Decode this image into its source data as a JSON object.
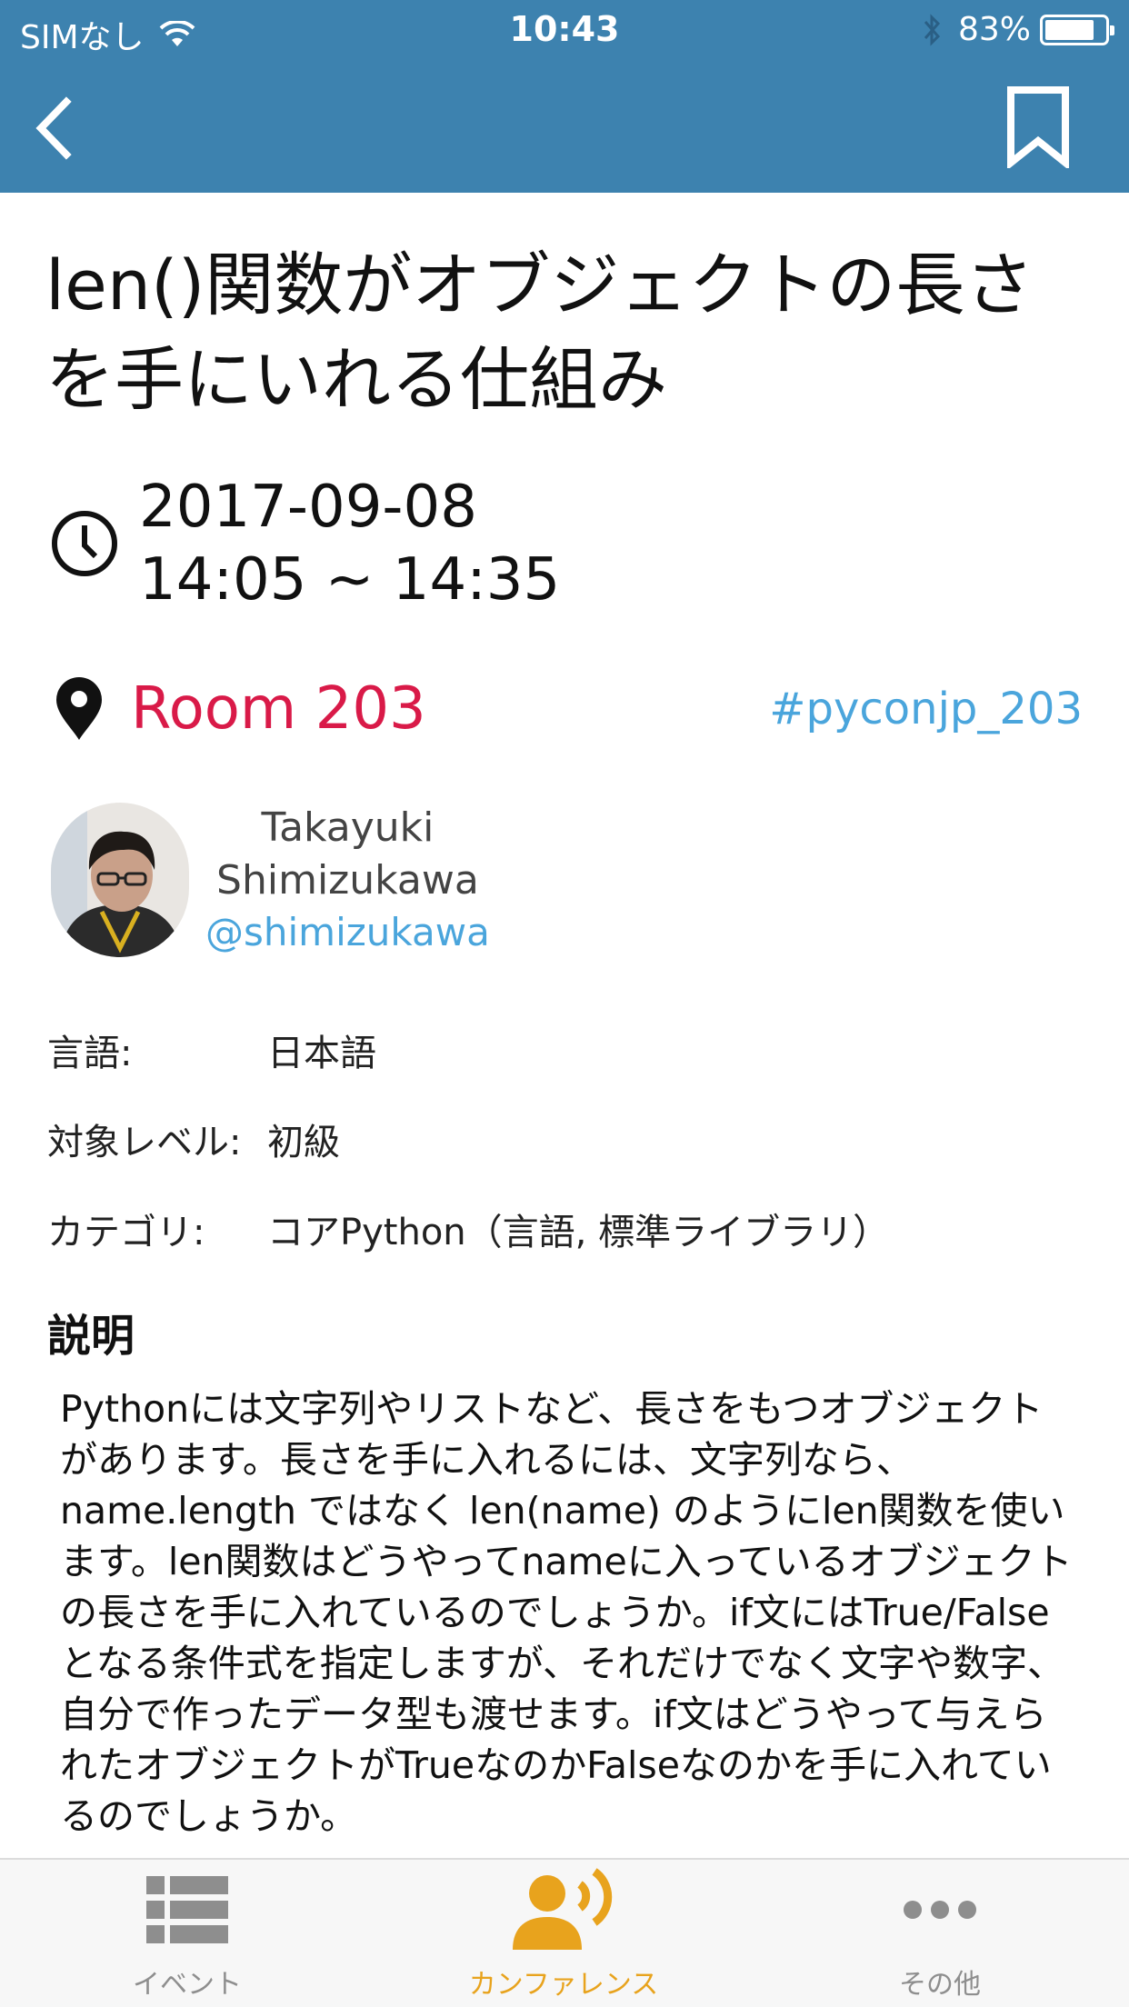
{
  "status_bar": {
    "carrier": "SIMなし",
    "time": "10:43",
    "battery": "83%",
    "battery_level": 0.83
  },
  "nav": {
    "back_icon": "chevron-left-icon",
    "bookmark_icon": "bookmark-icon"
  },
  "session": {
    "title": "len()関数がオブジェクトの長さを手にいれる仕組み",
    "date": "2017-09-08",
    "time": "14:05 ~ 14:35",
    "room": "Room 203",
    "hashtag": "#pyconjp_203"
  },
  "speaker": {
    "first_name": "Takayuki",
    "last_name": "Shimizukawa",
    "handle": "@shimizukawa"
  },
  "details": [
    {
      "label": "言語:",
      "value": "日本語"
    },
    {
      "label": "対象レベル:",
      "value": "初級"
    },
    {
      "label": "カテゴリ:",
      "value": "コアPython（言語, 標準ライブラリ）"
    }
  ],
  "description": {
    "heading": "説明",
    "body": "Pythonには文字列やリストなど、長さをもつオブジェクトがあります。長さを手に入れるには、文字列なら、name.length ではなく len(name) のようにlen関数を使います。len関数はどうやってnameに入っているオブジェクトの長さを手に入れているのでしょうか。if文にはTrue/Falseとなる条件式を指定しますが、それだけでなく文字や数字、自分で作ったデータ型も渡せます。if文はどうやって与えられたオブジェクトがTrueなのかFalseなのかを手に入れているのでしょうか。"
  },
  "tabs": [
    {
      "label": "イベント",
      "icon": "list-icon",
      "active": false
    },
    {
      "label": "カンファレンス",
      "icon": "speaker-icon",
      "active": true
    },
    {
      "label": "その他",
      "icon": "more-icon",
      "active": false
    }
  ],
  "colors": {
    "header": "#3d82af",
    "room": "#d91a48",
    "link": "#4aa5dc",
    "active_tab": "#e8a31d",
    "inactive_tab": "#8e8e8e"
  }
}
